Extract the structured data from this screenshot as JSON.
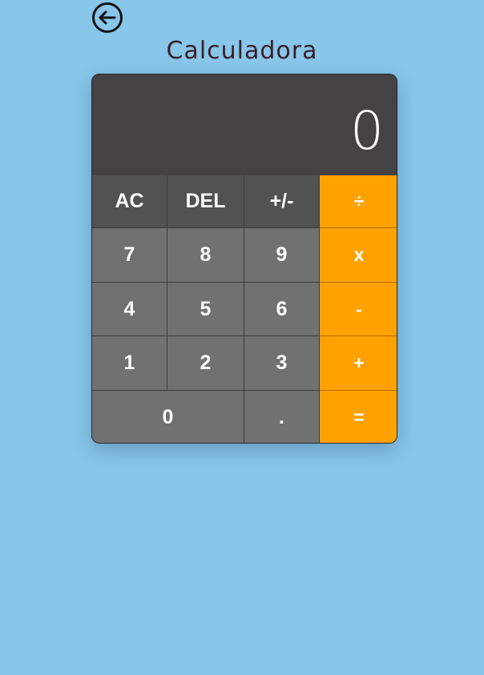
{
  "header": {
    "title": "Calculadora",
    "back_icon": "arrow-left-circle-icon"
  },
  "display": {
    "value": "0"
  },
  "keys": {
    "ac": "AC",
    "del": "DEL",
    "sign": "+/-",
    "divide": "÷",
    "seven": "7",
    "eight": "8",
    "nine": "9",
    "multiply": "x",
    "four": "4",
    "five": "5",
    "six": "6",
    "subtract": "-",
    "one": "1",
    "two": "2",
    "three": "3",
    "add": "+",
    "zero": "0",
    "decimal": ".",
    "equals": "="
  },
  "colors": {
    "background": "#88c6ea",
    "display": "#454244",
    "function_key": "#525252",
    "number_key": "#717171",
    "operator_key": "#ffa200",
    "title": "#3a1e26"
  }
}
